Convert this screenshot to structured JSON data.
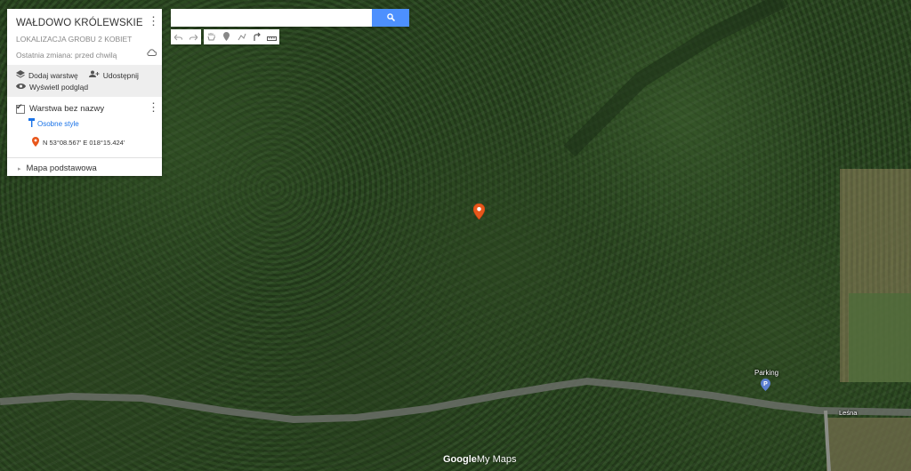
{
  "panel": {
    "title": "WAŁDOWO KRÓLEWSKIE",
    "subtitle": "LOKALIZACJA GROBU 2 KOBIET",
    "last_modified": "Ostatnia zmiana: przed chwilą",
    "actions": {
      "add_layer": "Dodaj warstwę",
      "share": "Udostępnij",
      "preview": "Wyświetl podgląd"
    },
    "layer": {
      "name": "Warstwa bez nazwy",
      "style_link": "Osobne style",
      "place": "N 53°08.567' E 018°15.424'"
    },
    "basemap": "Mapa podstawowa"
  },
  "search": {
    "placeholder": "",
    "value": ""
  },
  "map": {
    "parking_label": "Parking",
    "street_label": "Leśna",
    "logo_text": "Google",
    "logo_suffix": "My Maps"
  },
  "colors": {
    "marker": "#e8571c",
    "search_button": "#4d90fe",
    "parking": "#5b7fd0"
  }
}
